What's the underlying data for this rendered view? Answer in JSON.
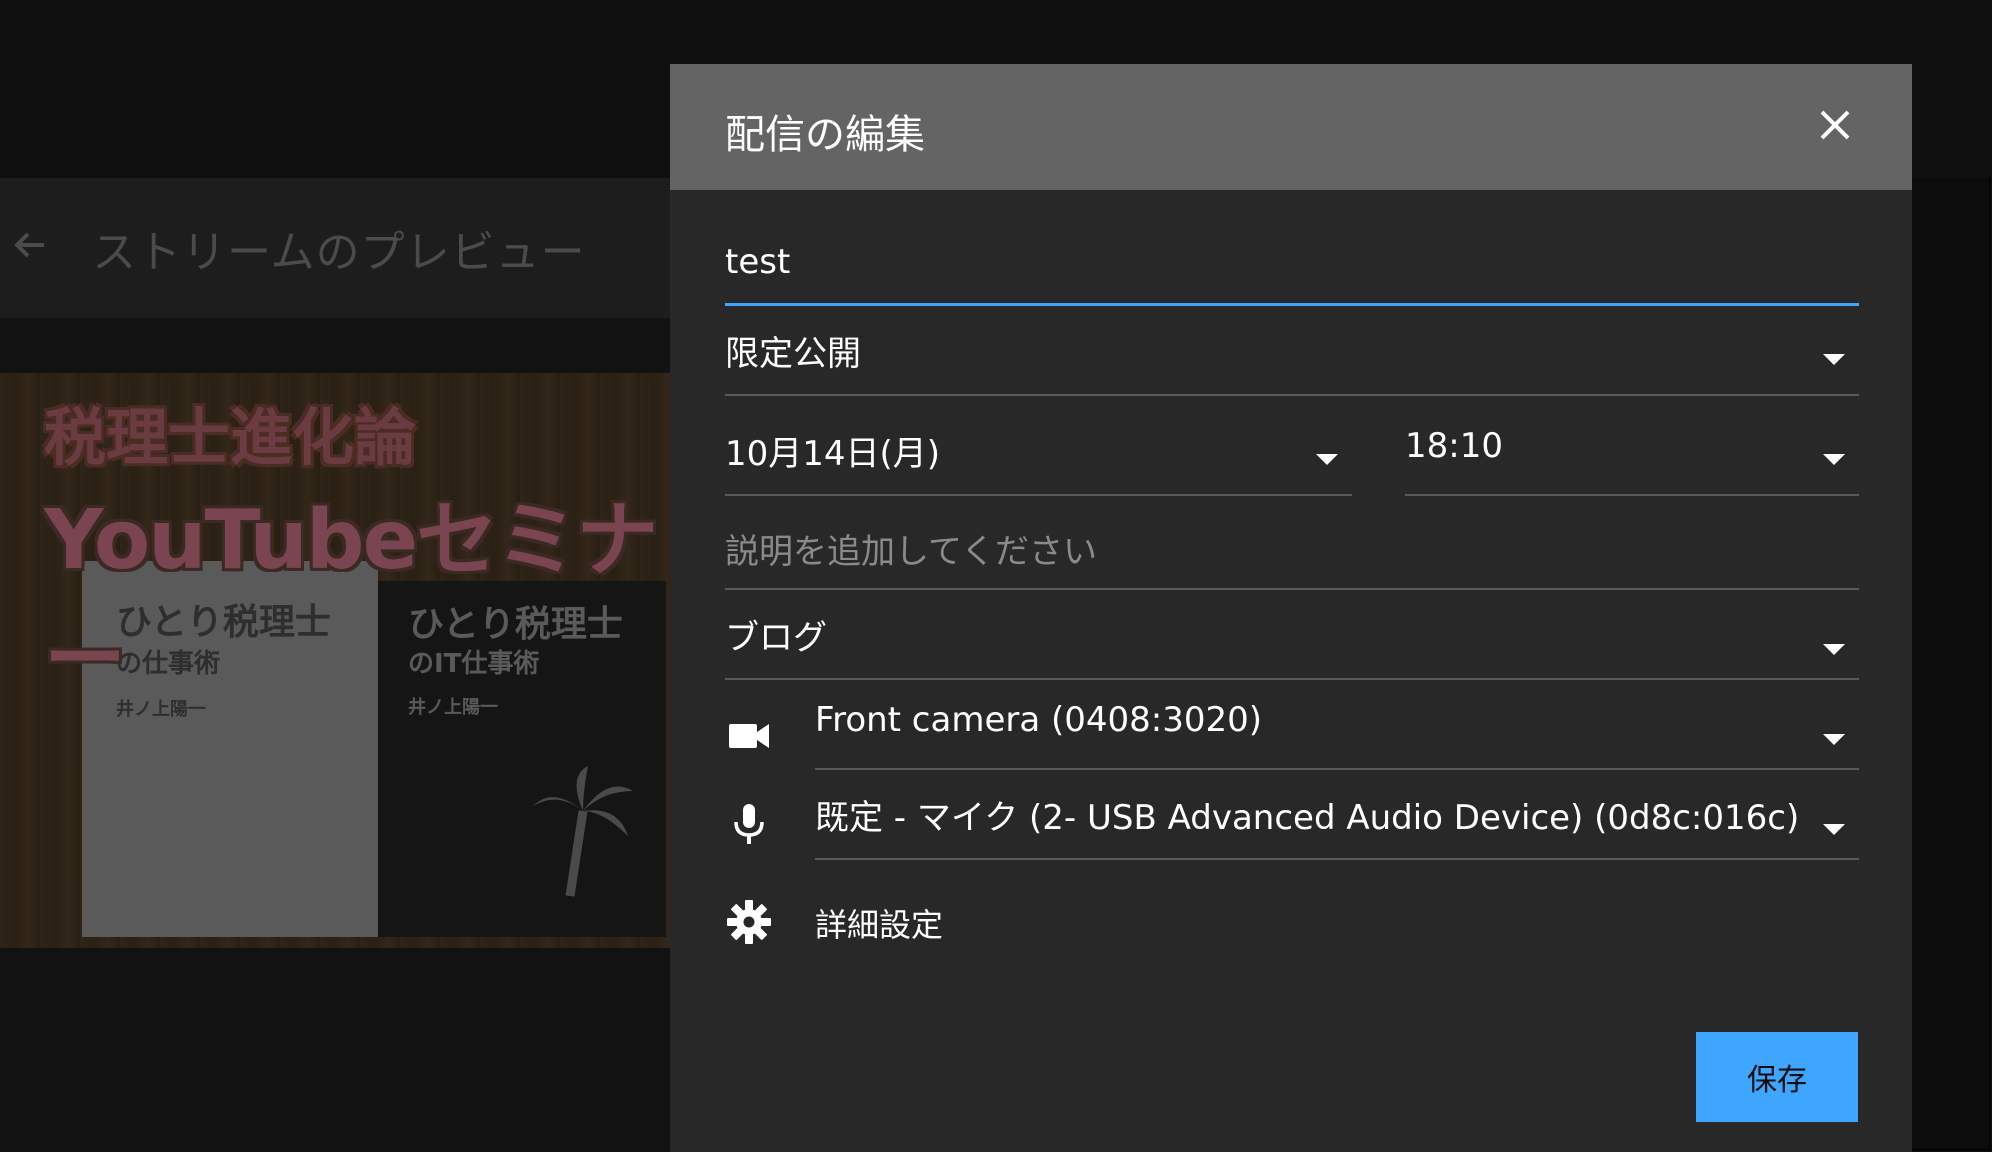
{
  "background": {
    "preview_title": "ストリームのプレビュー",
    "thumbnail": {
      "headline_1": "税理士進化論",
      "headline_2": "YouTubeセミナー",
      "book_1_title": "ひとり税理士",
      "book_1_sub": "の仕事術",
      "book_2_title": "ひとり税理士",
      "book_2_sub": "のIT仕事術",
      "book_author": "井ノ上陽一"
    }
  },
  "dialog": {
    "title": "配信の編集",
    "title_field": {
      "value": "test"
    },
    "visibility": {
      "selected": "限定公開"
    },
    "date": {
      "selected": "10月14日(月)"
    },
    "time": {
      "selected": "18:10"
    },
    "description": {
      "placeholder": "説明を追加してください"
    },
    "category": {
      "selected": "ブログ"
    },
    "camera": {
      "icon": "videocam-icon",
      "selected": "Front camera (0408:3020)"
    },
    "microphone": {
      "icon": "mic-icon",
      "selected": "既定 - マイク (2- USB Advanced Audio Device) (0d8c:016c)"
    },
    "advanced": {
      "icon": "gear-icon",
      "label": "詳細設定"
    },
    "save_label": "保存"
  },
  "colors": {
    "accent": "#3ea6ff",
    "dialog_bg": "#282828",
    "dialog_header": "#646464"
  }
}
